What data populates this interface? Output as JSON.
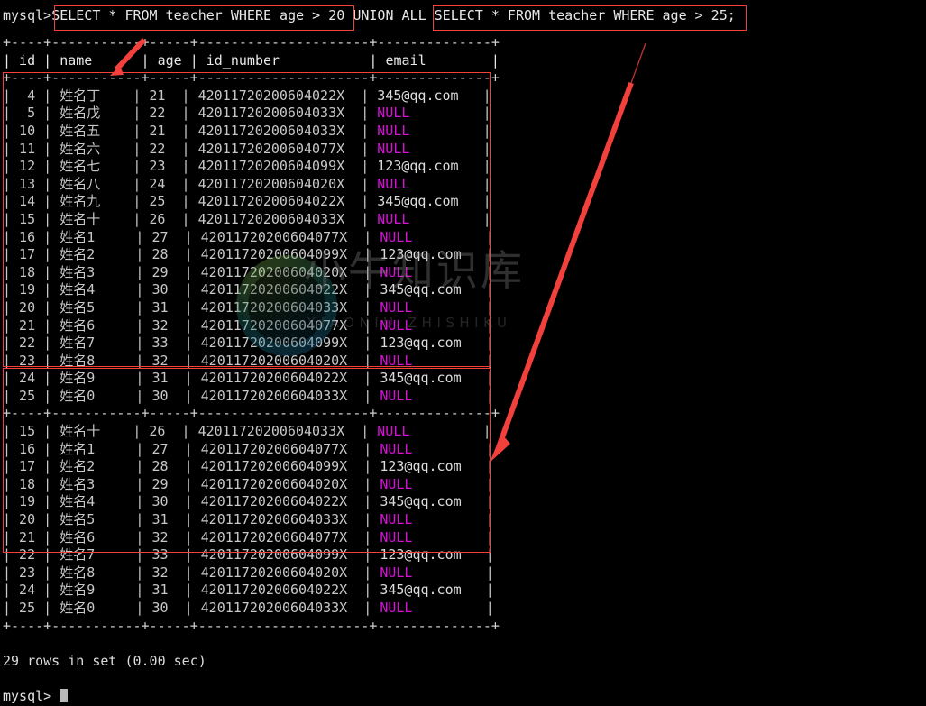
{
  "terminal": {
    "prompt": "mysql>",
    "query_left": "SELECT * FROM teacher WHERE age > 20",
    "query_middle": " UNION ALL ",
    "query_right": "SELECT * FROM teacher WHERE age > 25;",
    "result_status": "29 rows in set (0.00 sec)",
    "bottom_prompt": "mysql>"
  },
  "table": {
    "top_rule": "+----+-----------+-----+---------------------+--------------+",
    "header_line": "| id | name      | age | id_number           | email        |",
    "mid_rule": "+----+-----------+-----+---------------------+--------------+",
    "bottom_rule": "+----+-----------+-----+---------------------+--------------+",
    "columns": [
      "id",
      "name",
      "age",
      "id_number",
      "email"
    ],
    "rows": [
      {
        "id": "4",
        "name": "姓名丁",
        "age": "21",
        "id_number": "42011720200604022X",
        "email": "345@qq.com"
      },
      {
        "id": "5",
        "name": "姓名戊",
        "age": "22",
        "id_number": "42011720200604033X",
        "email": "NULL"
      },
      {
        "id": "10",
        "name": "姓名五",
        "age": "21",
        "id_number": "42011720200604033X",
        "email": "NULL"
      },
      {
        "id": "11",
        "name": "姓名六",
        "age": "22",
        "id_number": "42011720200604077X",
        "email": "NULL"
      },
      {
        "id": "12",
        "name": "姓名七",
        "age": "23",
        "id_number": "42011720200604099X",
        "email": "123@qq.com"
      },
      {
        "id": "13",
        "name": "姓名八",
        "age": "24",
        "id_number": "42011720200604020X",
        "email": "NULL"
      },
      {
        "id": "14",
        "name": "姓名九",
        "age": "25",
        "id_number": "42011720200604022X",
        "email": "345@qq.com"
      },
      {
        "id": "15",
        "name": "姓名十",
        "age": "26",
        "id_number": "42011720200604033X",
        "email": "NULL"
      },
      {
        "id": "16",
        "name": "姓名1",
        "age": "27",
        "id_number": "42011720200604077X",
        "email": "NULL"
      },
      {
        "id": "17",
        "name": "姓名2",
        "age": "28",
        "id_number": "42011720200604099X",
        "email": "123@qq.com"
      },
      {
        "id": "18",
        "name": "姓名3",
        "age": "29",
        "id_number": "42011720200604020X",
        "email": "NULL"
      },
      {
        "id": "19",
        "name": "姓名4",
        "age": "30",
        "id_number": "42011720200604022X",
        "email": "345@qq.com"
      },
      {
        "id": "20",
        "name": "姓名5",
        "age": "31",
        "id_number": "42011720200604033X",
        "email": "NULL"
      },
      {
        "id": "21",
        "name": "姓名6",
        "age": "32",
        "id_number": "42011720200604077X",
        "email": "NULL"
      },
      {
        "id": "22",
        "name": "姓名7",
        "age": "33",
        "id_number": "42011720200604099X",
        "email": "123@qq.com"
      },
      {
        "id": "23",
        "name": "姓名8",
        "age": "32",
        "id_number": "42011720200604020X",
        "email": "NULL"
      },
      {
        "id": "24",
        "name": "姓名9",
        "age": "31",
        "id_number": "42011720200604022X",
        "email": "345@qq.com"
      },
      {
        "id": "25",
        "name": "姓名0",
        "age": "30",
        "id_number": "42011720200604033X",
        "email": "NULL"
      },
      {
        "id": "15",
        "name": "姓名十",
        "age": "26",
        "id_number": "42011720200604033X",
        "email": "NULL"
      },
      {
        "id": "16",
        "name": "姓名1",
        "age": "27",
        "id_number": "42011720200604077X",
        "email": "NULL"
      },
      {
        "id": "17",
        "name": "姓名2",
        "age": "28",
        "id_number": "42011720200604099X",
        "email": "123@qq.com"
      },
      {
        "id": "18",
        "name": "姓名3",
        "age": "29",
        "id_number": "42011720200604020X",
        "email": "NULL"
      },
      {
        "id": "19",
        "name": "姓名4",
        "age": "30",
        "id_number": "42011720200604022X",
        "email": "345@qq.com"
      },
      {
        "id": "20",
        "name": "姓名5",
        "age": "31",
        "id_number": "42011720200604033X",
        "email": "NULL"
      },
      {
        "id": "21",
        "name": "姓名6",
        "age": "32",
        "id_number": "42011720200604077X",
        "email": "NULL"
      },
      {
        "id": "22",
        "name": "姓名7",
        "age": "33",
        "id_number": "42011720200604099X",
        "email": "123@qq.com"
      },
      {
        "id": "23",
        "name": "姓名8",
        "age": "32",
        "id_number": "42011720200604020X",
        "email": "NULL"
      },
      {
        "id": "24",
        "name": "姓名9",
        "age": "31",
        "id_number": "42011720200604022X",
        "email": "345@qq.com"
      },
      {
        "id": "25",
        "name": "姓名0",
        "age": "30",
        "id_number": "42011720200604033X",
        "email": "NULL"
      }
    ],
    "block_split_after_row": 18
  },
  "watermark": {
    "chinese": "小牛知识库",
    "english": "XIAONIU ZHISHIKU"
  },
  "annotations": {
    "colors": {
      "highlight": "#f2403c",
      "null_value": "#d810d8",
      "text": "#d8d8d8",
      "background": "#000000"
    },
    "boxes": [
      "query-left-box",
      "query-right-box",
      "result-block-1-box",
      "result-block-2-box"
    ],
    "arrows": [
      "arrow-to-first-block",
      "arrow-to-second-block"
    ]
  }
}
